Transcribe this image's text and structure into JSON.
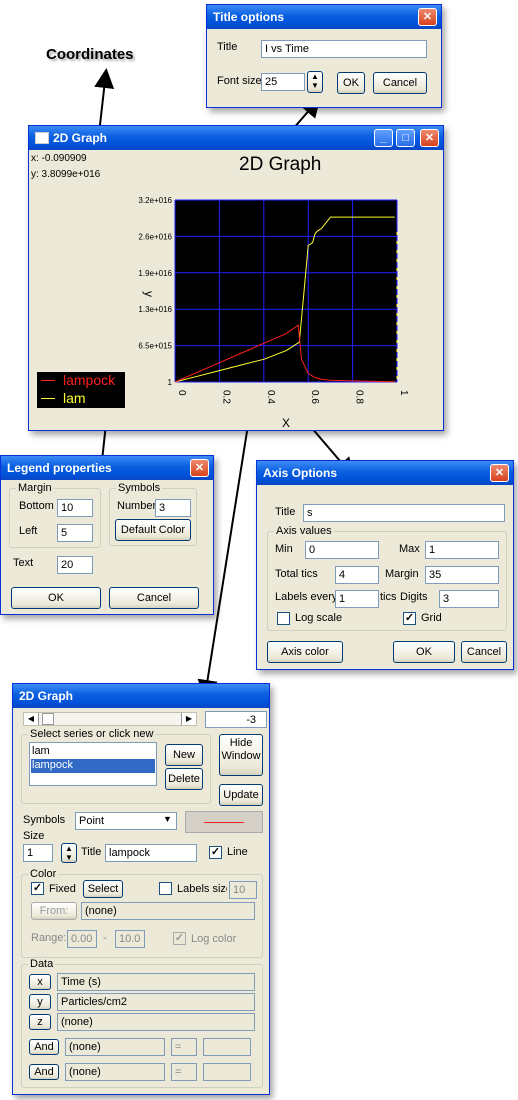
{
  "annotations": {
    "coordinates": "Coordinates"
  },
  "title_options": {
    "title": "Title options",
    "title_label": "Title",
    "title_value": "I vs Time",
    "font_size_label": "Font size",
    "font_size_value": "25",
    "ok": "OK",
    "cancel": "Cancel"
  },
  "graph_window": {
    "title": "2D Graph",
    "coord_x": "x: -0.090909",
    "coord_y": "y: 3.8099e+016",
    "graph_title": "2D Graph",
    "legend": [
      {
        "name": "lampock",
        "color": "#ff2020"
      },
      {
        "name": "lam",
        "color": "#ffff30"
      }
    ]
  },
  "chart_data": {
    "type": "line",
    "xlabel": "X",
    "ylabel": "y",
    "xlim": [
      0,
      1
    ],
    "ylim": [
      1,
      3.2e+16
    ],
    "x_ticks": [
      "0",
      "0.2",
      "0.4",
      "0.6",
      "0.8",
      "1"
    ],
    "y_ticks": [
      "3.2e+016",
      "2.6e+016",
      "1.9e+016",
      "1.3e+016",
      "6.5e+015",
      "1"
    ],
    "grid": true,
    "background": "#000000",
    "grid_color": "#2020ff",
    "series": [
      {
        "name": "lam",
        "color": "#ffff30",
        "x": [
          0,
          0.1,
          0.2,
          0.3,
          0.4,
          0.5,
          0.56,
          0.58,
          0.6,
          0.62,
          0.63,
          0.64,
          0.66,
          0.68,
          0.7,
          0.72,
          0.8,
          0.9,
          0.99
        ],
        "y": [
          0,
          1000000000000000.0,
          2000000000000000.0,
          3000000000000000.0,
          4000000000000000.0,
          5500000000000000.0,
          7000000000000000.0,
          1.55e+16,
          2.4e+16,
          2.45e+16,
          2.6e+16,
          2.65e+16,
          2.7e+16,
          2.8e+16,
          2.9e+16,
          2.9e+16,
          2.9e+16,
          2.9e+16,
          2.9e+16
        ]
      },
      {
        "name": "lampock",
        "color": "#ff2020",
        "x": [
          0,
          0.1,
          0.2,
          0.3,
          0.4,
          0.5,
          0.555,
          0.57,
          0.6,
          0.63,
          0.66,
          0.7,
          0.8,
          0.9,
          0.99
        ],
        "y": [
          0,
          1700000000000000.0,
          3400000000000000.0,
          5100000000000000.0,
          6800000000000000.0,
          8500000000000000.0,
          1e+16,
          4000000000000000.0,
          1500000000000000.0,
          800000000000000.0,
          500000000000000.0,
          300000000000000.0,
          200000000000000.0,
          100000000000000.0,
          50000000000000.0
        ]
      }
    ]
  },
  "legend_properties": {
    "title": "Legend properties",
    "margin_label": "Margin",
    "bottom_label": "Bottom",
    "bottom_value": "10",
    "left_label": "Left",
    "left_value": "5",
    "symbols_label": "Symbols",
    "number_label": "Number",
    "number_value": "3",
    "default_color": "Default Color",
    "text_label": "Text",
    "text_value": "20",
    "ok": "OK",
    "cancel": "Cancel"
  },
  "axis_options": {
    "title": "Axis Options",
    "title_label": "Title",
    "title_value": "s",
    "axis_values_label": "Axis values",
    "min_label": "Min",
    "min_value": "0",
    "max_label": "Max",
    "max_value": "1",
    "total_tics_label": "Total tics",
    "total_tics_value": "4",
    "margin_label": "Margin",
    "margin_value": "35",
    "labels_every_label": "Labels every",
    "labels_every_value": "1",
    "tics_label": "tics",
    "digits_label": "Digits",
    "digits_value": "3",
    "log_scale_label": "Log scale",
    "grid_label": "Grid",
    "axis_color": "Axis color",
    "ok": "OK",
    "cancel": "Cancel"
  },
  "series_panel": {
    "title": "2D Graph",
    "scroll_value": "-3",
    "select_label": "Select series or click new",
    "series_list": [
      "lam",
      "lampock"
    ],
    "new": "New",
    "delete": "Delete",
    "hide_window": "Hide Window",
    "update": "Update",
    "symbols_label": "Symbols",
    "symbol_value": "Point",
    "size_label": "Size",
    "size_value": "1",
    "title_label": "Title",
    "title_value": "lampock",
    "line_label": "Line",
    "color_label": "Color",
    "fixed_label": "Fixed",
    "select": "Select",
    "labels_size_label": "Labels size",
    "labels_size_value": "10",
    "from": "From:",
    "from_value": "(none)",
    "range_label": "Range:",
    "range_min": "0.00",
    "range_dash": "-",
    "range_max": "10.0",
    "log_color_label": "Log color",
    "data_label": "Data",
    "x_btn": "x",
    "x_value": "Time (s)",
    "y_btn": "y",
    "y_value": "Particles/cm2",
    "z_btn": "z",
    "z_value": "(none)",
    "and_btn": "And",
    "and1_value": "(none)",
    "and1_op": "=",
    "and2_value": "(none)",
    "and2_op": "="
  }
}
